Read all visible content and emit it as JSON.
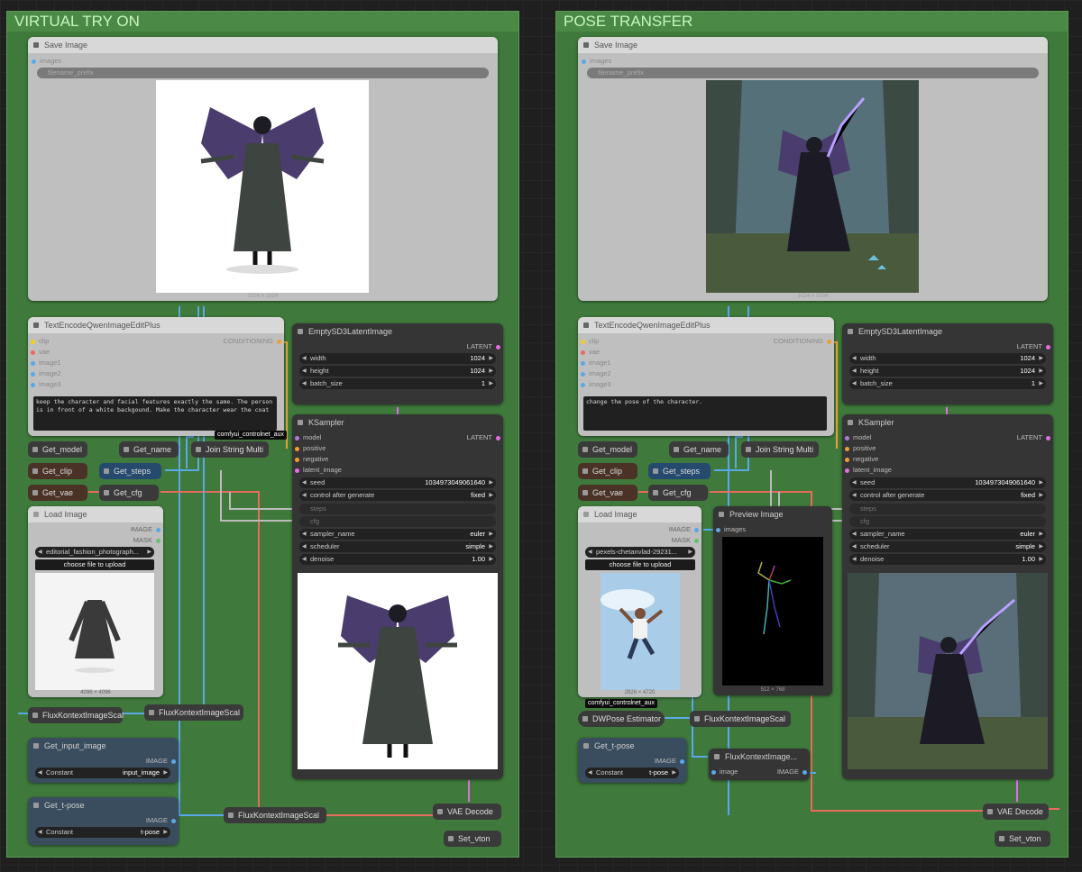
{
  "groups": {
    "left": {
      "title": "VIRTUAL TRY ON"
    },
    "right": {
      "title": "POSE TRANSFER"
    }
  },
  "left": {
    "save_image": {
      "title": "Save Image",
      "input_images": "images",
      "filename_prefix": "filename_prefix",
      "caption": "1024 × 1024"
    },
    "text_encode": {
      "title": "TextEncodeQwenImageEditPlus",
      "inputs": [
        "clip",
        "vae",
        "image1",
        "image2",
        "image3"
      ],
      "output": "CONDITIONING",
      "prompt": "keep the character and facial features exactly the same. The person is in front of a white backgound. Make the character wear the coat"
    },
    "empty_latent": {
      "title": "EmptySD3LatentImage",
      "output": "LATENT",
      "width_label": "width",
      "width": "1024",
      "height_label": "height",
      "height": "1024",
      "batch_label": "batch_size",
      "batch": "1"
    },
    "ksampler": {
      "title": "KSampler",
      "inputs": [
        "model",
        "positive",
        "negative",
        "latent_image"
      ],
      "output": "LATENT",
      "seed_label": "seed",
      "seed": "1034973049061640",
      "control_label": "control after generate",
      "control": "fixed",
      "steps_label": "steps",
      "cfg_label": "cfg",
      "sampler_label": "sampler_name",
      "sampler": "euler",
      "scheduler_label": "scheduler",
      "scheduler": "simple",
      "denoise_label": "denoise",
      "denoise": "1.00"
    },
    "get_model": "Get_model",
    "get_name": "Get_name",
    "join_string": "Join String Multi",
    "get_clip": "Get_clip",
    "get_steps": "Get_steps",
    "get_vae": "Get_vae",
    "get_cfg": "Get_cfg",
    "load_image": {
      "title": "Load Image",
      "out_image": "IMAGE",
      "out_mask": "MASK",
      "file": "editorial_fashion_photograph...",
      "upload": "choose file to upload",
      "caption": "4096 × 4096"
    },
    "flux_a": "FluxKontextImageScal",
    "flux_b": "FluxKontextImageScal",
    "get_input_image": {
      "title": "Get_input_image",
      "output": "IMAGE",
      "const_label": "Constant",
      "const_value": "input_image"
    },
    "get_tpose": {
      "title": "Get_t-pose",
      "output": "IMAGE",
      "const_label": "Constant",
      "const_value": "t-pose"
    },
    "flux_c": "FluxKontextImageScal",
    "vae_decode": "VAE Decode",
    "set_vton": "Set_vton",
    "badge": "comfyui_controlnet_aux"
  },
  "right": {
    "save_image": {
      "title": "Save Image",
      "input_images": "images",
      "filename_prefix": "filename_prefix",
      "caption": "1024 × 1024"
    },
    "text_encode": {
      "title": "TextEncodeQwenImageEditPlus",
      "inputs": [
        "clip",
        "vae",
        "image1",
        "image2",
        "image3"
      ],
      "output": "CONDITIONING",
      "prompt": "change the pose of the character."
    },
    "empty_latent": {
      "title": "EmptySD3LatentImage",
      "output": "LATENT",
      "width_label": "width",
      "width": "1024",
      "height_label": "height",
      "height": "1024",
      "batch_label": "batch_size",
      "batch": "1"
    },
    "ksampler": {
      "title": "KSampler",
      "inputs": [
        "model",
        "positive",
        "negative",
        "latent_image"
      ],
      "output": "LATENT",
      "seed_label": "seed",
      "seed": "1034973049061640",
      "control_label": "control after generate",
      "control": "fixed",
      "steps_label": "steps",
      "cfg_label": "cfg",
      "sampler_label": "sampler_name",
      "sampler": "euler",
      "scheduler_label": "scheduler",
      "scheduler": "simple",
      "denoise_label": "denoise",
      "denoise": "1.00"
    },
    "get_model": "Get_model",
    "get_name": "Get_name",
    "join_string": "Join String Multi",
    "get_clip": "Get_clip",
    "get_steps": "Get_steps",
    "get_vae": "Get_vae",
    "get_cfg": "Get_cfg",
    "load_image": {
      "title": "Load Image",
      "out_image": "IMAGE",
      "out_mask": "MASK",
      "file": "pexels-chetanvlad-29231...",
      "upload": "choose file to upload",
      "caption": "2826 × 4720"
    },
    "preview_image": {
      "title": "Preview Image",
      "input": "images",
      "caption": "512 × 768"
    },
    "badge": "comfyui_controlnet_aux",
    "dwpose": "DWPose Estimator",
    "flux_a": "FluxKontextImageScal",
    "get_tpose": {
      "title": "Get_t-pose",
      "output": "IMAGE",
      "const_label": "Constant",
      "const_value": "t-pose"
    },
    "flux_b": {
      "title": "FluxKontextImage...",
      "input": "image",
      "output": "IMAGE"
    },
    "vae_decode": "VAE Decode",
    "set_vton": "Set_vton"
  },
  "colors": {
    "group_green": "#3f7a3c",
    "wire_blue": "#5aa8e6",
    "wire_red": "#e86b5e",
    "wire_orange": "#f0a030",
    "wire_pink": "#e070e0",
    "wire_grey": "#bbbbbb"
  }
}
